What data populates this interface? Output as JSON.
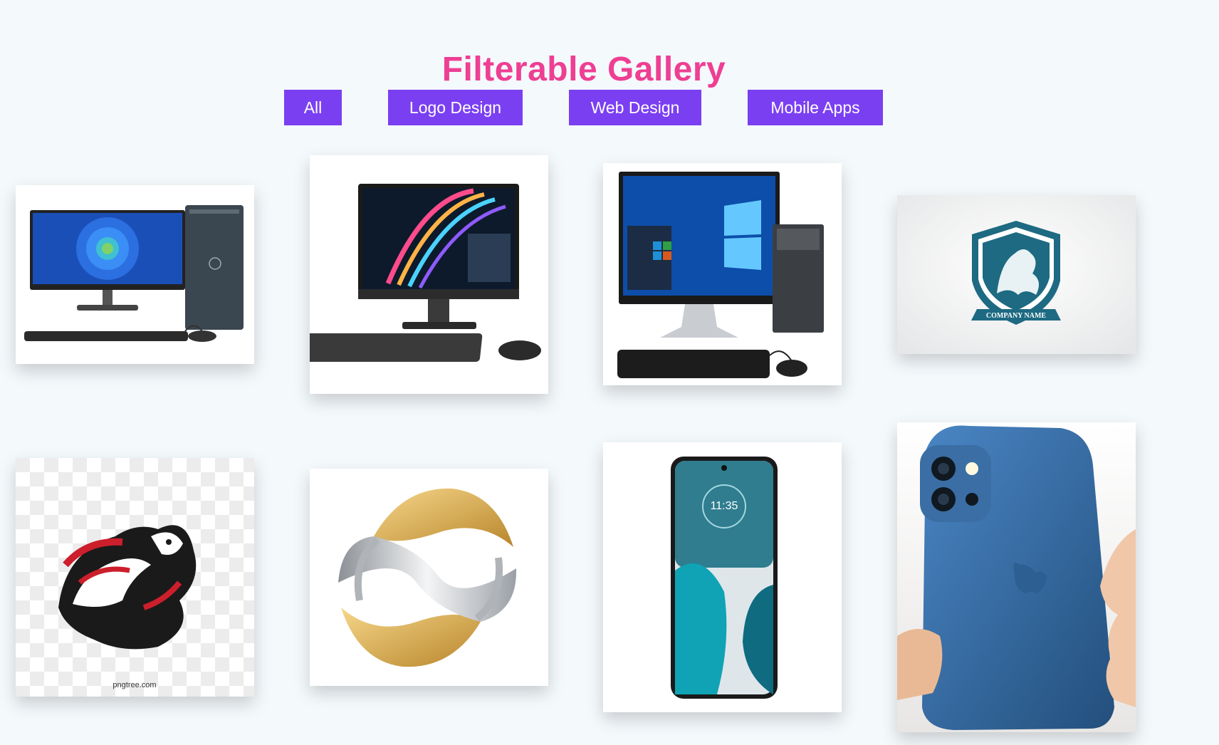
{
  "header": {
    "title": "Filterable Gallery"
  },
  "filters": [
    {
      "label": "All"
    },
    {
      "label": "Logo Design"
    },
    {
      "label": "Web Design"
    },
    {
      "label": "Mobile Apps"
    }
  ],
  "gallery": {
    "items": [
      {
        "icon": "desktop-pc-flower-wallpaper-image"
      },
      {
        "icon": "all-in-one-pc-image"
      },
      {
        "icon": "desktop-pc-windows-image"
      },
      {
        "icon": "shield-company-logo-image",
        "caption": "COMPANY NAME"
      },
      {
        "icon": "lion-tribal-logo-image",
        "caption": "pngtree.com"
      },
      {
        "icon": "gold-silver-sphere-logo-image"
      },
      {
        "icon": "android-phone-image",
        "caption": "11:35"
      },
      {
        "icon": "blue-iphone-in-hand-image"
      }
    ]
  },
  "colors": {
    "background": "#f4f9fc",
    "title": "#ee3f93",
    "button": "#7b3ff2",
    "button_text": "#ffffff"
  }
}
